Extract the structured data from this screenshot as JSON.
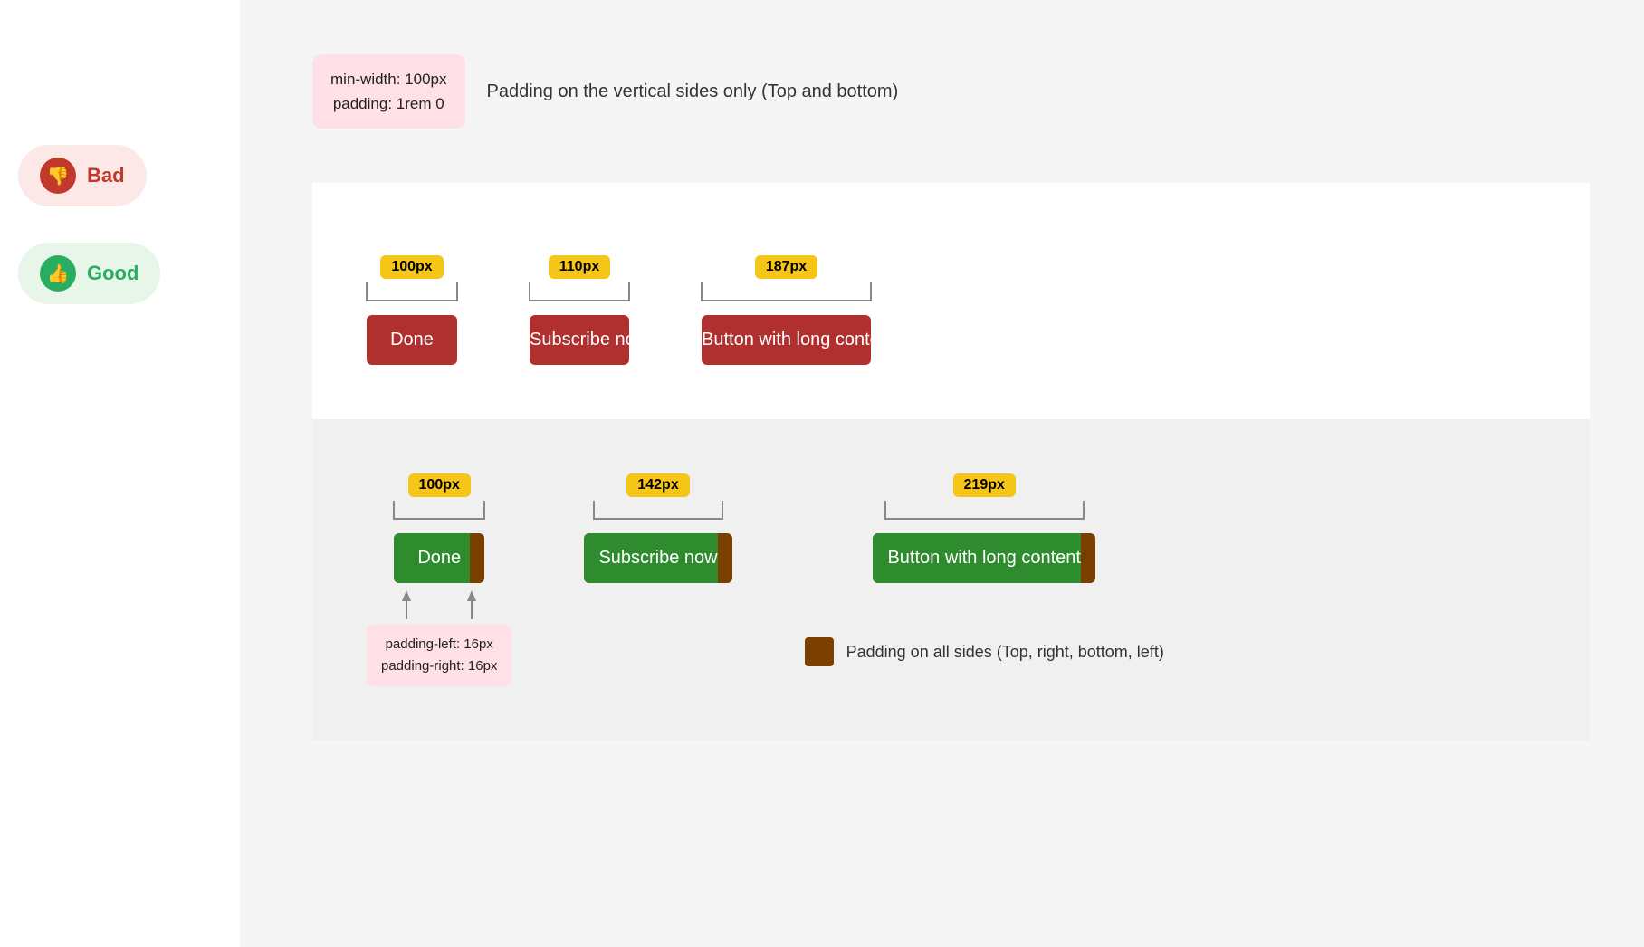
{
  "sidebar": {
    "bad_label": "Bad",
    "good_label": "Good"
  },
  "top": {
    "code_box": "min-width: 100px\npadding: 1rem 0",
    "description": "Padding on the vertical sides only (Top and bottom)"
  },
  "bad": {
    "buttons": [
      {
        "width_label": "100px",
        "text": "Done",
        "css_class": "btn-bad-done"
      },
      {
        "width_label": "110px",
        "text": "Subscribe now",
        "css_class": "btn-bad-subscribe"
      },
      {
        "width_label": "187px",
        "text": "Button with long content",
        "css_class": "btn-bad-long"
      }
    ]
  },
  "good": {
    "buttons": [
      {
        "width_label": "100px",
        "text": "Done",
        "css_class": "btn-good-done"
      },
      {
        "width_label": "142px",
        "text": "Subscribe now",
        "css_class": "btn-good-subscribe"
      },
      {
        "width_label": "219px",
        "text": "Button with long content",
        "css_class": "btn-good-long"
      }
    ],
    "annotation": "padding-left: 16px\npadding-right: 16px",
    "legend_text": "Padding on all sides (Top, right, bottom, left)"
  }
}
